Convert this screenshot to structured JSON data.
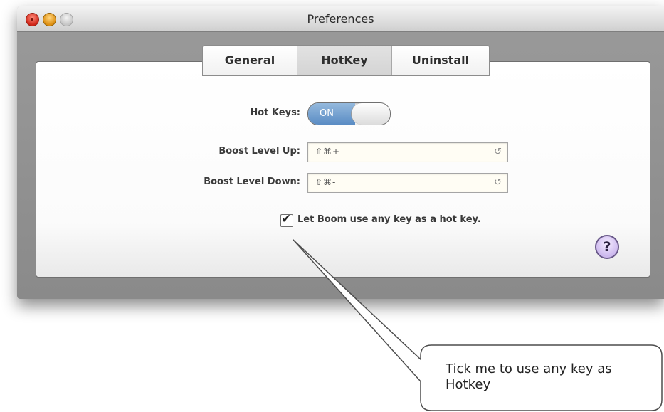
{
  "window": {
    "title": "Preferences"
  },
  "tabs": [
    {
      "label": "General"
    },
    {
      "label": "HotKey"
    },
    {
      "label": "Uninstall"
    }
  ],
  "hotkey_panel": {
    "hot_keys_label": "Hot Keys:",
    "hot_keys_toggle": {
      "state_label": "ON",
      "value": true
    },
    "boost_up_label": "Boost Level Up:",
    "boost_up_value": "⇧⌘+",
    "boost_down_label": "Boost Level Down:",
    "boost_down_value": "⇧⌘-",
    "any_key_checkbox": {
      "label": "Let Boom use any key as a hot key.",
      "checked": true
    },
    "help_label": "?"
  },
  "callout": {
    "text": "Tick me to use any key as Hotkey"
  },
  "icons": {
    "reset": "reset-icon",
    "check": "checkmark-icon"
  }
}
